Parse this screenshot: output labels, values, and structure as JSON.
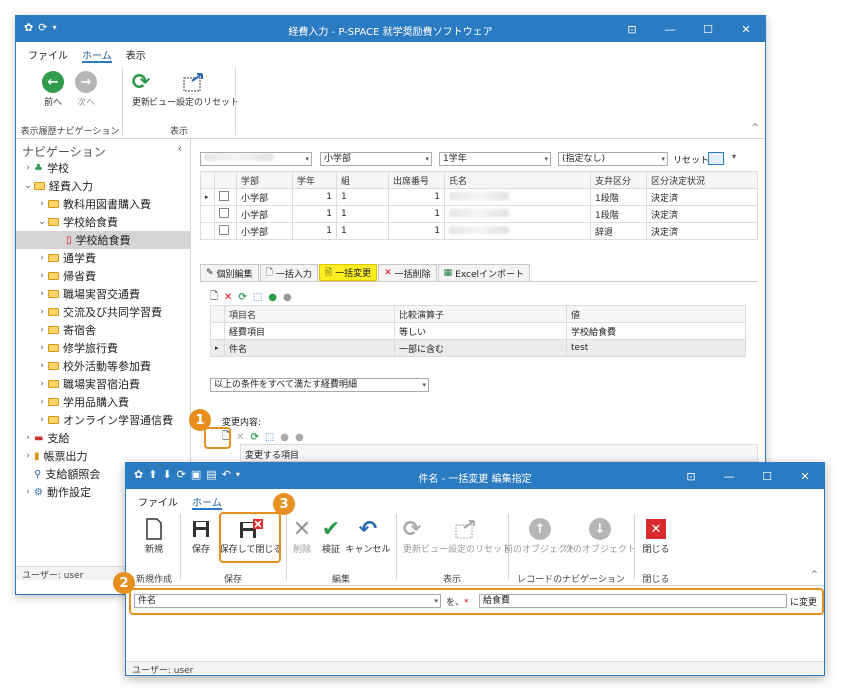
{
  "main_window": {
    "title": "経費入力 - P-SPACE 就学奨励費ソフトウェア",
    "menu_tabs": [
      "ファイル",
      "ホーム",
      "表示"
    ],
    "ribbon": {
      "back": "前へ",
      "forward": "次へ",
      "refresh": "更新",
      "view_reset": "ビュー設定のリセット",
      "group_history": "表示履歴ナビゲーション",
      "group_view": "表示"
    },
    "nav_header": "ナビゲーション",
    "nav_items": [
      {
        "label": "学校",
        "level": 0,
        "type": "school"
      },
      {
        "label": "経費入力",
        "level": 0,
        "type": "folder"
      },
      {
        "label": "教科用図書購入費",
        "level": 1,
        "type": "folder"
      },
      {
        "label": "学校給食費",
        "level": 1,
        "type": "folder"
      },
      {
        "label": "学校給食費",
        "level": 2,
        "type": "doc"
      },
      {
        "label": "通学費",
        "level": 1,
        "type": "folder"
      },
      {
        "label": "帰省費",
        "level": 1,
        "type": "folder"
      },
      {
        "label": "職場実習交通費",
        "level": 1,
        "type": "folder"
      },
      {
        "label": "交流及び共同学習費",
        "level": 1,
        "type": "folder"
      },
      {
        "label": "寄宿舎",
        "level": 1,
        "type": "folder"
      },
      {
        "label": "修学旅行費",
        "level": 1,
        "type": "folder"
      },
      {
        "label": "校外活動等参加費",
        "level": 1,
        "type": "folder"
      },
      {
        "label": "職場実習宿泊費",
        "level": 1,
        "type": "folder"
      },
      {
        "label": "学用品購入費",
        "level": 1,
        "type": "folder"
      },
      {
        "label": "オンライン学習通信費",
        "level": 1,
        "type": "folder"
      },
      {
        "label": "支給",
        "level": 0,
        "type": "pay"
      },
      {
        "label": "帳票出力",
        "level": 0,
        "type": "report"
      },
      {
        "label": "支給額照会",
        "level": 0,
        "type": "search"
      },
      {
        "label": "動作設定",
        "level": 0,
        "type": "gear"
      }
    ],
    "status": "ユーザー: user",
    "filters": {
      "dept": "小学部",
      "grade": "1学年",
      "spec": "(指定なし)",
      "reset": "リセット"
    },
    "table_headers": [
      "学部",
      "学年",
      "組",
      "出席番号",
      "氏名",
      "支弁区分",
      "区分決定状況"
    ],
    "rows": [
      {
        "dept": "小学部",
        "grade": "1",
        "class": "1",
        "no": "1",
        "level": "1段階",
        "status": "決定済"
      },
      {
        "dept": "小学部",
        "grade": "1",
        "class": "1",
        "no": "1",
        "level": "1段階",
        "status": "決定済"
      },
      {
        "dept": "小学部",
        "grade": "1",
        "class": "1",
        "no": "1",
        "level": "辞退",
        "status": "決定済"
      }
    ],
    "sub_tabs": [
      "個別編集",
      "一括入力",
      "一括変更",
      "一括削除",
      "Excelインポート"
    ],
    "cond_headers": [
      "項目名",
      "比較演算子",
      "値"
    ],
    "cond_rows": [
      {
        "item": "経費項目",
        "op": "等しい",
        "val": "学校給食費"
      },
      {
        "item": "件名",
        "op": "一部に含む",
        "val": "test"
      }
    ],
    "cond_mode": "以上の条件をすべて満たす経費明細",
    "change_label": "変更内容:",
    "change_header": "変更する項目"
  },
  "dialog": {
    "title": "件名 - 一括変更 編集指定",
    "menu_tabs": [
      "ファイル",
      "ホーム"
    ],
    "buttons": {
      "new": "新規",
      "save": "保存",
      "save_close": "保存して閉じる",
      "delete": "削除",
      "verify": "検証",
      "cancel": "キャンセル",
      "refresh": "更新",
      "view_reset": "ビュー設定のリセット",
      "prev": "前のオブジェクト",
      "next": "次のオブジェクト",
      "close": "閉じる"
    },
    "groups": [
      "新規作成",
      "保存",
      "編集",
      "表示",
      "レコードのナビゲーション",
      "閉じる"
    ],
    "field": "件名",
    "wo": "を、",
    "required": "*",
    "value": "給食費",
    "suffix": "に変更",
    "status": "ユーザー: user"
  },
  "callouts": [
    "1",
    "2",
    "3"
  ],
  "colors": {
    "titlebar": "#2b7bc3",
    "callout": "#e7901f",
    "highlight": "#fcee1f"
  }
}
